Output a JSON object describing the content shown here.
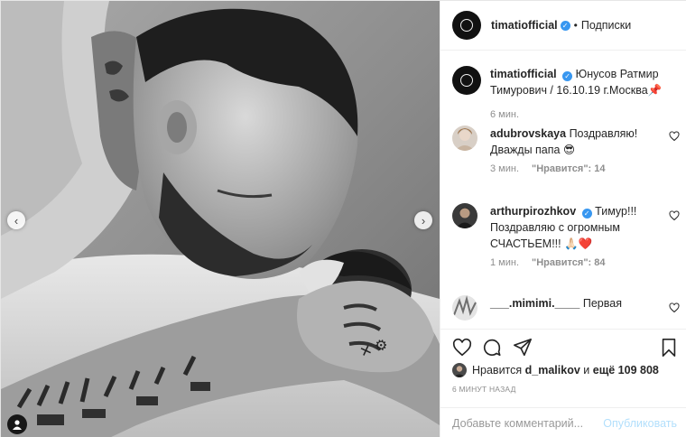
{
  "post": {
    "author": "timatiofficial",
    "separator": "•",
    "follow_label": "Подписки",
    "caption": {
      "user": "timatiofficial",
      "text": "Юнусов Ратмир Тимурович / 16.10.19 г.Москва📌",
      "time": "6 мин."
    }
  },
  "comments": [
    {
      "user": "adubrovskaya",
      "text": "Поздравляю! Дважды папа 😎",
      "time": "3 мин.",
      "likes": "\"Нравится\": 14"
    },
    {
      "user": "arthurpirozhkov",
      "verified": true,
      "text": "Тимур!!! Поздравляю с огромным СЧАСТЬЕМ!!! 🙏🏻❤️",
      "time": "1 мин.",
      "likes": "\"Нравится\": 84"
    },
    {
      "user": "___.mimimi.____",
      "text": "Первая"
    }
  ],
  "likes_line": {
    "prefix": "Нравится",
    "user": "d_malikov",
    "joiner": "и",
    "rest": "ещё 109 808"
  },
  "timestamp": "6 МИНУТ НАЗАД",
  "add_comment": {
    "placeholder": "Добавьте комментарий...",
    "publish_label": "Опубликовать"
  },
  "icons": [
    "heart-icon",
    "comment-icon",
    "share-icon",
    "bookmark-icon",
    "tag-user-icon",
    "chevron-left-icon",
    "chevron-right-icon"
  ],
  "colors": {
    "link": "#b2dffc",
    "verified": "#3897f0",
    "text": "#262626",
    "muted": "#8e8e8e",
    "heart": "#ed4956"
  }
}
